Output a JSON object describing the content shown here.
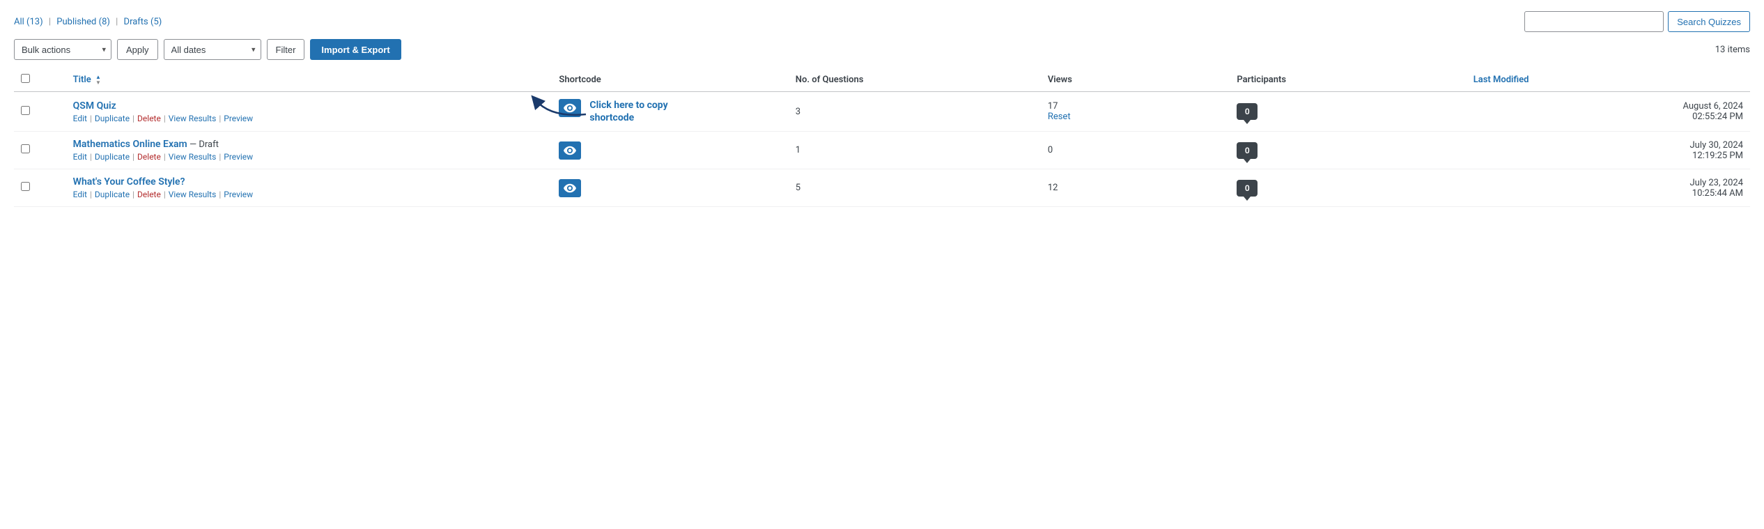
{
  "filter_links": {
    "all_label": "All",
    "all_count": "13",
    "published_label": "Published",
    "published_count": "8",
    "drafts_label": "Drafts",
    "drafts_count": "5"
  },
  "search": {
    "placeholder": "",
    "button_label": "Search Quizzes"
  },
  "toolbar": {
    "bulk_actions_label": "Bulk actions",
    "apply_label": "Apply",
    "all_dates_label": "All dates",
    "filter_label": "Filter",
    "import_export_label": "Import & Export",
    "items_count": "13 items"
  },
  "table": {
    "headers": {
      "title": "Title",
      "shortcode": "Shortcode",
      "no_of_questions": "No. of Questions",
      "views": "Views",
      "participants": "Participants",
      "last_modified": "Last Modified"
    },
    "rows": [
      {
        "title": "QSM Quiz",
        "subtitle": "",
        "actions": [
          "Edit",
          "Duplicate",
          "Delete",
          "View Results",
          "Preview"
        ],
        "questions": "3",
        "views": "17",
        "views_reset": "Reset",
        "participants": "0",
        "modified": "August 6, 2024",
        "modified_time": "02:55:24 PM",
        "show_tooltip": true
      },
      {
        "title": "Mathematics Online Exam",
        "subtitle": "— Draft",
        "actions": [
          "Edit",
          "Duplicate",
          "Delete",
          "View Results",
          "Preview"
        ],
        "questions": "1",
        "views": "0",
        "views_reset": "",
        "participants": "0",
        "modified": "July 30, 2024",
        "modified_time": "12:19:25 PM",
        "show_tooltip": false
      },
      {
        "title": "What's Your Coffee Style?",
        "subtitle": "",
        "actions": [
          "Edit",
          "Duplicate",
          "Delete",
          "View Results",
          "Preview"
        ],
        "questions": "5",
        "views": "12",
        "views_reset": "",
        "participants": "0",
        "modified": "July 23, 2024",
        "modified_time": "10:25:44 AM",
        "show_tooltip": false
      }
    ]
  },
  "tooltip": {
    "line1": "Click here to copy",
    "line2": "shortcode"
  },
  "icons": {
    "eye_icon": "👁",
    "sort_up": "▲",
    "sort_down": "▼"
  }
}
